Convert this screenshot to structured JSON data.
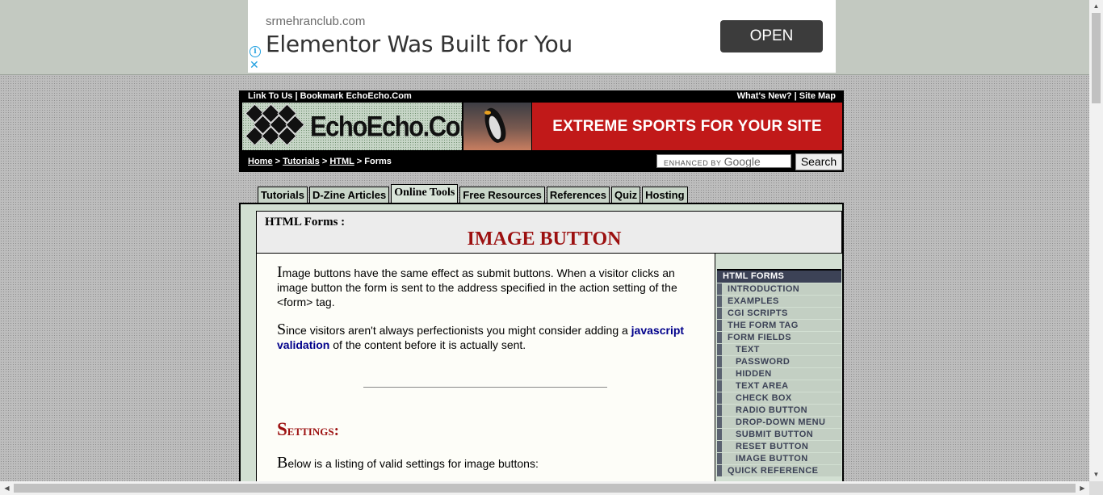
{
  "ad": {
    "domain": "srmehranclub.com",
    "headline": "Elementor Was Built for You",
    "cta": "OPEN",
    "info_icon": "info-icon",
    "close_icon": "close-icon"
  },
  "header": {
    "top_left": "Link To Us | Bookmark EchoEcho.Com",
    "top_right": "What's New? | Site Map",
    "logo_text": "EchoEcho.Com",
    "banner_text": "EXTREME SPORTS FOR YOUR SITE",
    "search_label": "ENHANCED BY",
    "search_brand": "Google",
    "search_button": "Search"
  },
  "breadcrumb": {
    "items": [
      "Home",
      "Tutorials",
      "HTML"
    ],
    "sep": ">",
    "current": "Forms"
  },
  "tabs": [
    "Tutorials",
    "D-Zine Articles",
    "Online Tools",
    "Free Resources",
    "References",
    "Quiz",
    "Hosting"
  ],
  "active_tab": "Online Tools",
  "page": {
    "section": "HTML Forms :",
    "title": "IMAGE BUTTON",
    "p1_cap": "I",
    "p1": "mage buttons have the same effect as submit buttons. When a visitor clicks an image button the form is sent to the address specified in the action setting of the <form> tag.",
    "p2_cap": "S",
    "p2_a": "ince visitors aren't always perfectionists you might consider adding a ",
    "p2_link": "javascript validation",
    "p2_b": " of the content before it is actually sent.",
    "settings_cap": "S",
    "settings_rest": "ettings:",
    "p3_cap": "B",
    "p3": "elow is a listing of valid settings for image buttons:"
  },
  "sidenav": {
    "heading": "HTML FORMS",
    "items": [
      {
        "label": "INTRODUCTION",
        "sub": false
      },
      {
        "label": "EXAMPLES",
        "sub": false
      },
      {
        "label": "CGI SCRIPTS",
        "sub": false
      },
      {
        "label": "THE FORM TAG",
        "sub": false
      },
      {
        "label": "FORM FIELDS",
        "sub": false
      },
      {
        "label": "TEXT",
        "sub": true
      },
      {
        "label": "PASSWORD",
        "sub": true
      },
      {
        "label": "HIDDEN",
        "sub": true
      },
      {
        "label": "TEXT AREA",
        "sub": true
      },
      {
        "label": "CHECK BOX",
        "sub": true
      },
      {
        "label": "RADIO BUTTON",
        "sub": true
      },
      {
        "label": "DROP-DOWN MENU",
        "sub": true
      },
      {
        "label": "SUBMIT BUTTON",
        "sub": true
      },
      {
        "label": "RESET BUTTON",
        "sub": true
      },
      {
        "label": "IMAGE BUTTON",
        "sub": true
      },
      {
        "label": "QUICK REFERENCE",
        "sub": false
      }
    ]
  },
  "colors": {
    "banner": "#c11919",
    "title_red": "#9c1010",
    "nav_dark": "#3c4256",
    "link": "#00008b"
  }
}
